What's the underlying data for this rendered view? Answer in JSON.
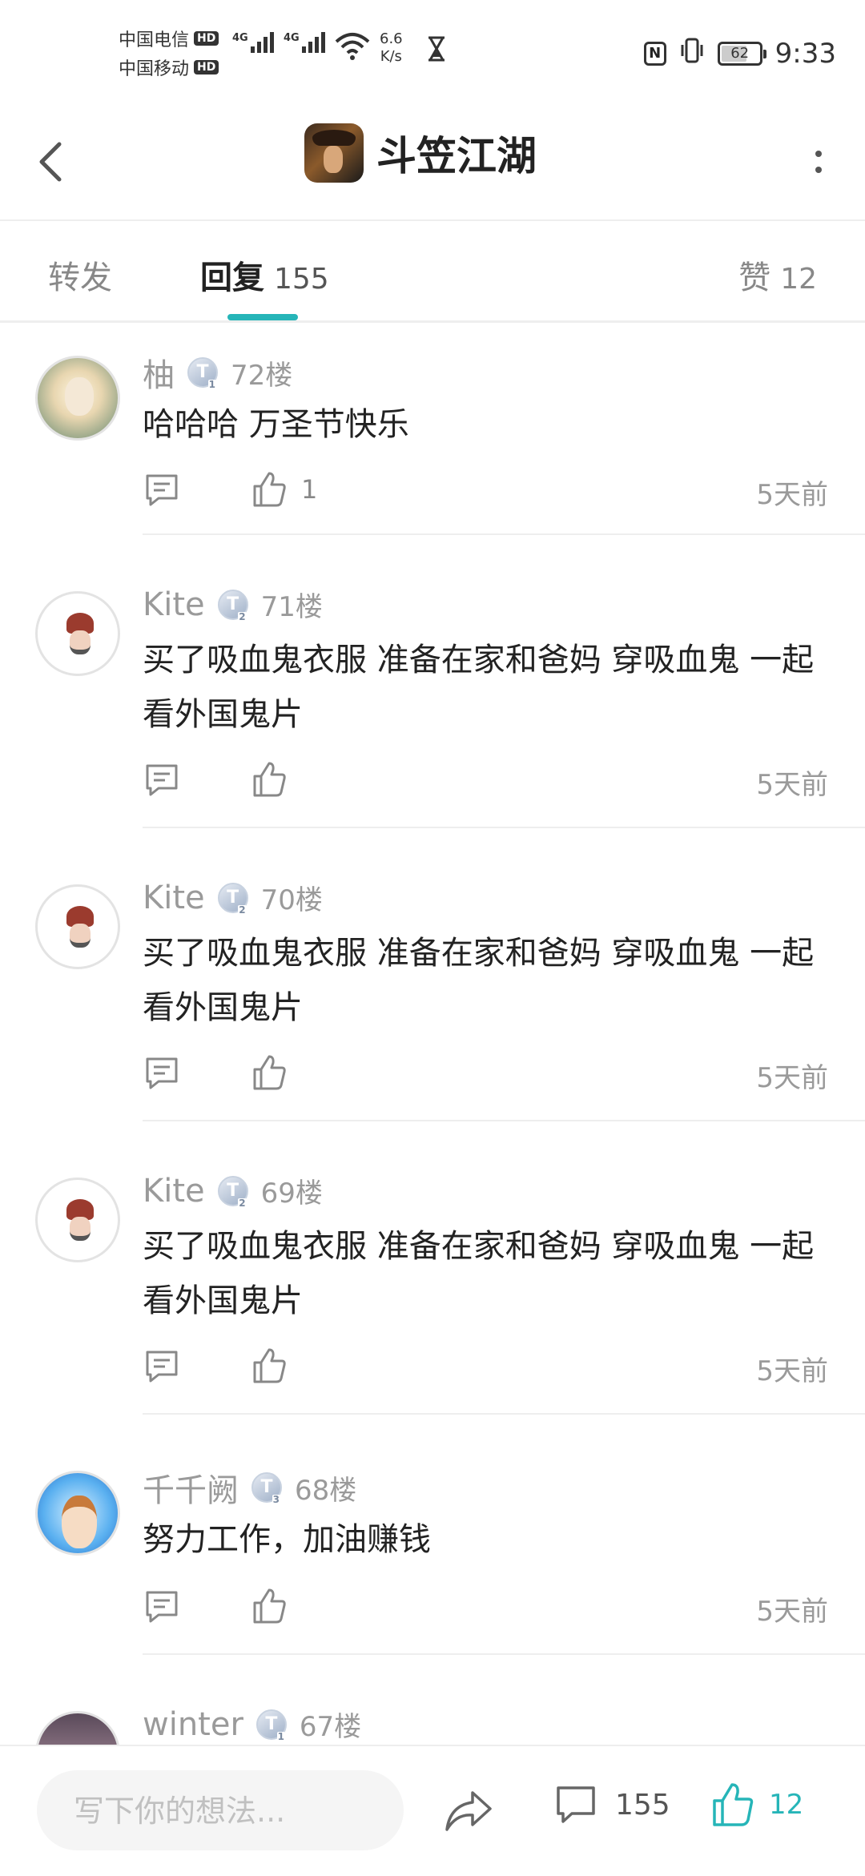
{
  "status_bar": {
    "carrier1": "中国电信",
    "carrier2": "中国移动",
    "hd": "HD",
    "net1": "4G",
    "net2": "4G",
    "speed_value": "6.6",
    "speed_unit": "K/s",
    "battery": "62",
    "time": "9:33"
  },
  "header": {
    "title": "斗笠江湖",
    "game_icon": "game-avatar"
  },
  "tabs": {
    "forward_label": "转发",
    "reply_label": "回复",
    "reply_count": "155",
    "like_label": "赞",
    "like_count": "12",
    "active": "reply"
  },
  "comments": [
    {
      "user": "柚",
      "level": "T",
      "level_num": "1",
      "floor": "72楼",
      "text": "哈哈哈 万圣节快乐",
      "likes": "1",
      "time": "5天前",
      "avatar": "anime-girl"
    },
    {
      "user": "Kite",
      "level": "T",
      "level_num": "2",
      "floor": "71楼",
      "text": "买了吸血鬼衣服 准备在家和爸妈 穿吸血鬼 一起看外国鬼片",
      "likes": "",
      "time": "5天前",
      "avatar": "red-hair-boy"
    },
    {
      "user": "Kite",
      "level": "T",
      "level_num": "2",
      "floor": "70楼",
      "text": "买了吸血鬼衣服 准备在家和爸妈 穿吸血鬼 一起看外国鬼片",
      "likes": "",
      "time": "5天前",
      "avatar": "red-hair-boy"
    },
    {
      "user": "Kite",
      "level": "T",
      "level_num": "2",
      "floor": "69楼",
      "text": "买了吸血鬼衣服 准备在家和爸妈 穿吸血鬼 一起看外国鬼片",
      "likes": "",
      "time": "5天前",
      "avatar": "red-hair-boy"
    },
    {
      "user": "千千阙",
      "level": "T",
      "level_num": "3",
      "floor": "68楼",
      "text": "努力工作，加油赚钱",
      "likes": "",
      "time": "5天前",
      "avatar": "blue-anime-boy"
    },
    {
      "user": "winter",
      "level": "T",
      "level_num": "1",
      "floor": "67楼",
      "text": "",
      "likes": "",
      "time": "",
      "avatar": "winter-avatar"
    }
  ],
  "bottom_bar": {
    "input_placeholder": "写下你的想法...",
    "comment_count": "155",
    "like_count": "12"
  },
  "colors": {
    "accent": "#26b5b8",
    "text_primary": "#222222",
    "text_secondary": "#9a9a9a",
    "divider": "#eeeeee"
  }
}
